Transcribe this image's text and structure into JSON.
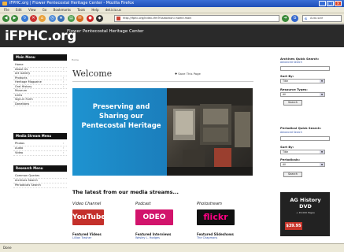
{
  "window": {
    "title": "iFPHC.org | Flower Pentecostal Heritage Center - Mozilla Firefox"
  },
  "menu": [
    "File",
    "Edit",
    "View",
    "Go",
    "Bookmarks",
    "Tools",
    "Help",
    "del.icio.us"
  ],
  "browser": {
    "url": "http://ifphc.org/index.cfm?fuseaction=home.main",
    "search_engine": "Google",
    "search_placeholder": "Auto-size"
  },
  "site": {
    "logo": "iFPHC.org",
    "tagline": "Flower Pentecostal Heritage Center"
  },
  "sidebar": {
    "main_heading": "Main Menu",
    "main_items": [
      {
        "label": "Home",
        "arrow": false
      },
      {
        "label": "About Us",
        "arrow": true
      },
      {
        "label": "Art Gallery",
        "arrow": false
      },
      {
        "label": "Products",
        "arrow": true
      },
      {
        "label": "Heritage Magazine",
        "arrow": true
      },
      {
        "label": "Oral History",
        "arrow": true
      },
      {
        "label": "Museum",
        "arrow": false
      },
      {
        "label": "Links",
        "arrow": false
      },
      {
        "label": "Sign-in Form",
        "arrow": false
      },
      {
        "label": "Donations",
        "arrow": false
      }
    ],
    "media_heading": "Media Stream Menu",
    "media_items": [
      {
        "label": "Photos",
        "arrow": true
      },
      {
        "label": "Audio",
        "arrow": true
      },
      {
        "label": "Video",
        "arrow": true
      }
    ],
    "research_heading": "Research Menu",
    "research_items": [
      {
        "label": "Common Queries",
        "arrow": false
      },
      {
        "label": "Archives Search",
        "arrow": false
      },
      {
        "label": "Periodicals Search",
        "arrow": false
      }
    ]
  },
  "main": {
    "breadcrumb": "Home",
    "heading": "Welcome",
    "save_link": "Save This Page",
    "hero_text": "Preserving and Sharing our Pentecostal Heritage",
    "streams_title": "The latest from our media streams...",
    "streams": [
      {
        "heading": "Video Channel",
        "logo": "YouTube",
        "feature": "Featured Videos",
        "link": "Lillian Trasher"
      },
      {
        "heading": "Podcast",
        "logo": "ODEO",
        "feature": "Featured Interviews",
        "link": "Wesley L. Hodges"
      },
      {
        "heading": "Photostream",
        "logo": "flickr",
        "feature": "Featured Slideshows",
        "link": "The Chapmans"
      }
    ]
  },
  "right": {
    "archives": {
      "title": "Archives Quick Search:",
      "advanced": "Advanced Search",
      "sort_label": "Sort By:",
      "sort_value": "Title",
      "types_label": "Resource Types:",
      "types_value": "All",
      "button": "Search"
    },
    "periodical": {
      "title": "Periodical Quick Search:",
      "advanced": "Advanced Search",
      "sort_label": "Sort By:",
      "sort_value": "Title",
      "periodicals_label": "Periodicals:",
      "periodicals_value": "All",
      "button": "Search"
    },
    "ad": {
      "title": "AG History DVD",
      "subtitle": "+ 45,000 Pages",
      "price": "$39.95"
    }
  },
  "status": "Done",
  "colors": {
    "titlebar": "#1f4fb8",
    "header": "#2a2a2a",
    "hero_blue": "#1e93d0",
    "youtube": "#c4302b",
    "odeo": "#d2146c",
    "flickr": "#ff0084"
  }
}
